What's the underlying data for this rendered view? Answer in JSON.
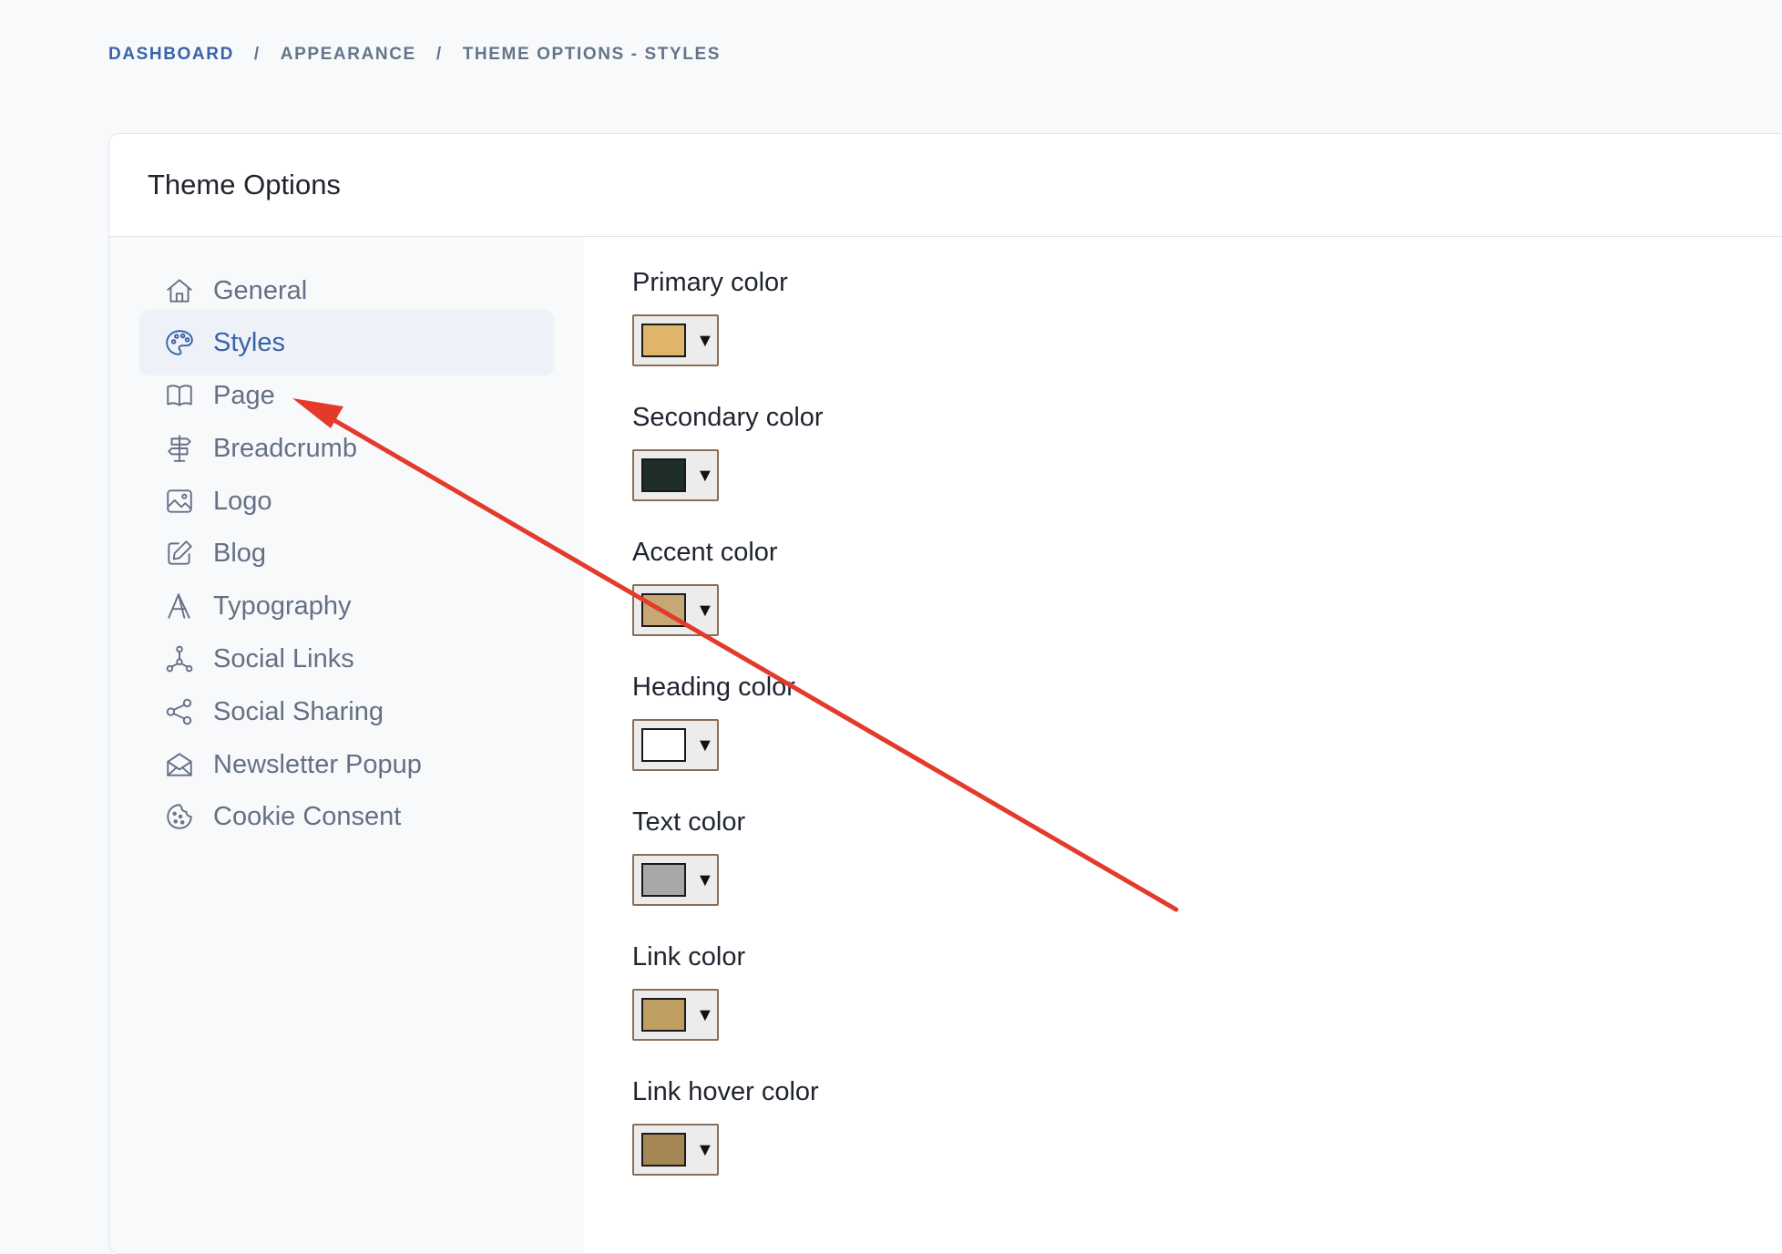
{
  "breadcrumb": {
    "items": [
      "DASHBOARD",
      "APPEARANCE",
      "THEME OPTIONS - STYLES"
    ],
    "separator": "/"
  },
  "card": {
    "title": "Theme Options"
  },
  "sidebar": {
    "items": [
      {
        "label": "General",
        "icon": "home-icon"
      },
      {
        "label": "Styles",
        "icon": "palette-icon",
        "active": true
      },
      {
        "label": "Page",
        "icon": "book-icon"
      },
      {
        "label": "Breadcrumb",
        "icon": "signpost-icon"
      },
      {
        "label": "Logo",
        "icon": "image-icon"
      },
      {
        "label": "Blog",
        "icon": "edit-icon"
      },
      {
        "label": "Typography",
        "icon": "typography-icon"
      },
      {
        "label": "Social Links",
        "icon": "social-links-icon"
      },
      {
        "label": "Social Sharing",
        "icon": "share-icon"
      },
      {
        "label": "Newsletter Popup",
        "icon": "mail-open-icon"
      },
      {
        "label": "Cookie Consent",
        "icon": "cookie-icon"
      }
    ]
  },
  "styles": {
    "fields": [
      {
        "label": "Primary color",
        "value": "#dfb46b"
      },
      {
        "label": "Secondary color",
        "value": "#1f2d2b"
      },
      {
        "label": "Accent color",
        "value": "#c7a874"
      },
      {
        "label": "Heading color",
        "value": "#ffffff"
      },
      {
        "label": "Text color",
        "value": "#a8a8a8"
      },
      {
        "label": "Link color",
        "value": "#bf9f61"
      },
      {
        "label": "Link hover color",
        "value": "#a58756"
      }
    ],
    "picker_indicator": "▼"
  },
  "annotation": {
    "arrow_color": "#e43a2c"
  },
  "colors": {
    "accent": "#3a63a6",
    "muted_text": "#647085",
    "active_bg": "#eef2f8"
  }
}
